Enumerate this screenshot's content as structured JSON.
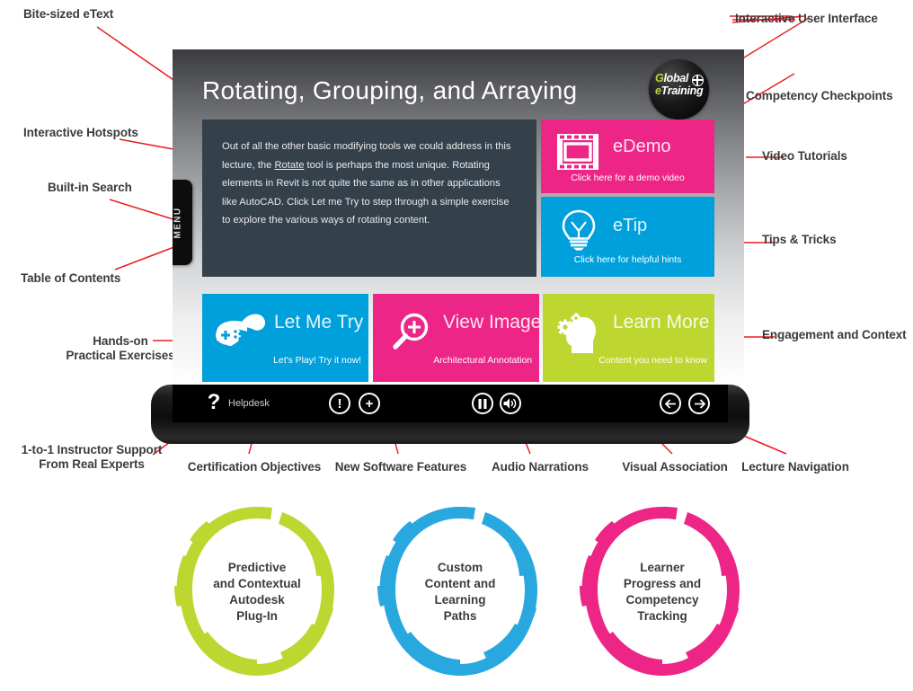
{
  "screen": {
    "title": "Rotating, Grouping, and Arraying",
    "logo": {
      "line1_a": "G",
      "line1_b": "lobal",
      "line2_a": "e",
      "line2_b": "Training",
      "globe_icon": "globe-icon"
    },
    "menu_tab_label": "MENU",
    "body_text_parts": {
      "before": "Out of all the other basic modifying tools we could address in this lecture, the ",
      "underlined": "Rotate",
      "after": " tool is perhaps the most unique.  Rotating elements in Revit is not quite the same as in other applications like AutoCAD.  Click Let me Try to step through a simple exercise to explore the various ways of rotating content."
    },
    "tiles": [
      {
        "id": "edemo",
        "title": "eDemo",
        "subtitle": "Click here for a demo video",
        "color": "#EC2586",
        "icon": "film-strip-icon"
      },
      {
        "id": "etip",
        "title": "eTip",
        "subtitle": "Click here for helpful hints",
        "color": "#00A0DC",
        "icon": "lightbulb-icon"
      },
      {
        "id": "letmetry",
        "title": "Let Me Try",
        "subtitle": "Let's Play! Try it now!",
        "color": "#00A0DC",
        "icon": "gamepad-icon"
      },
      {
        "id": "viewimage",
        "title": "View Image",
        "subtitle": "Architectural Annotation",
        "color": "#EC2586",
        "icon": "magnifier-plus-icon"
      },
      {
        "id": "learnmore",
        "title": "Learn More",
        "subtitle": "Content you need to know",
        "color": "#BED630",
        "icon": "head-gears-icon"
      }
    ],
    "toolbar": {
      "helpdesk_label": "Helpdesk",
      "buttons": [
        {
          "name": "helpdesk-button",
          "icon": "question-mark-icon",
          "glyph": "?"
        },
        {
          "name": "objectives-button",
          "icon": "exclamation-circle-icon",
          "glyph": "!"
        },
        {
          "name": "new-features-button",
          "icon": "plus-circle-icon",
          "glyph": "+"
        },
        {
          "name": "pause-button",
          "icon": "pause-circle-icon",
          "glyph": "II"
        },
        {
          "name": "audio-button",
          "icon": "speaker-circle-icon",
          "glyph": "volume"
        },
        {
          "name": "previous-button",
          "icon": "arrow-left-circle-icon",
          "glyph": "←"
        },
        {
          "name": "next-button",
          "icon": "arrow-right-circle-icon",
          "glyph": "→"
        }
      ]
    }
  },
  "callouts": {
    "left": [
      {
        "id": "bite-sized-etext",
        "text": "Bite-sized eText"
      },
      {
        "id": "interactive-hotspots",
        "text": "Interactive Hotspots"
      },
      {
        "id": "built-in-search",
        "text": "Built-in Search"
      },
      {
        "id": "table-of-contents",
        "text": "Table of Contents"
      },
      {
        "id": "hands-on-practical-exercises",
        "text": "Hands-on\nPractical Exercises"
      },
      {
        "id": "instructor-support",
        "text": "1-to-1 Instructor Support\nFrom Real Experts"
      }
    ],
    "right": [
      {
        "id": "interactive-user-interface",
        "text": "Interactive User Interface"
      },
      {
        "id": "competency-checkpoints",
        "text": "Competency Checkpoints"
      },
      {
        "id": "video-tutorials",
        "text": "Video Tutorials"
      },
      {
        "id": "tips-and-tricks",
        "text": "Tips & Tricks"
      },
      {
        "id": "engagement-and-context",
        "text": "Engagement and Context"
      }
    ],
    "bottom": [
      {
        "id": "certification-objectives",
        "text": "Certification Objectives"
      },
      {
        "id": "new-software-features",
        "text": "New Software Features"
      },
      {
        "id": "audio-narrations",
        "text": "Audio Narrations"
      },
      {
        "id": "visual-association",
        "text": "Visual Association"
      },
      {
        "id": "lecture-navigation",
        "text": "Lecture Navigation"
      }
    ]
  },
  "circles": [
    {
      "id": "predictive-contextual",
      "text": "Predictive\nand Contextual\nAutodesk\nPlug-In",
      "color": "#BED630"
    },
    {
      "id": "custom-content",
      "text": "Custom\nContent and\nLearning\nPaths",
      "color": "#29A8DF"
    },
    {
      "id": "learner-progress",
      "text": "Learner\nProgress and\nCompetency\nTracking",
      "color": "#EC2586"
    }
  ],
  "colors": {
    "magenta": "#EC2586",
    "cyan": "#00A0DC",
    "lime": "#BED630",
    "panel_dark": "#34414B",
    "leader_line": "#ED1C24",
    "label_text": "#3B3B3B"
  }
}
